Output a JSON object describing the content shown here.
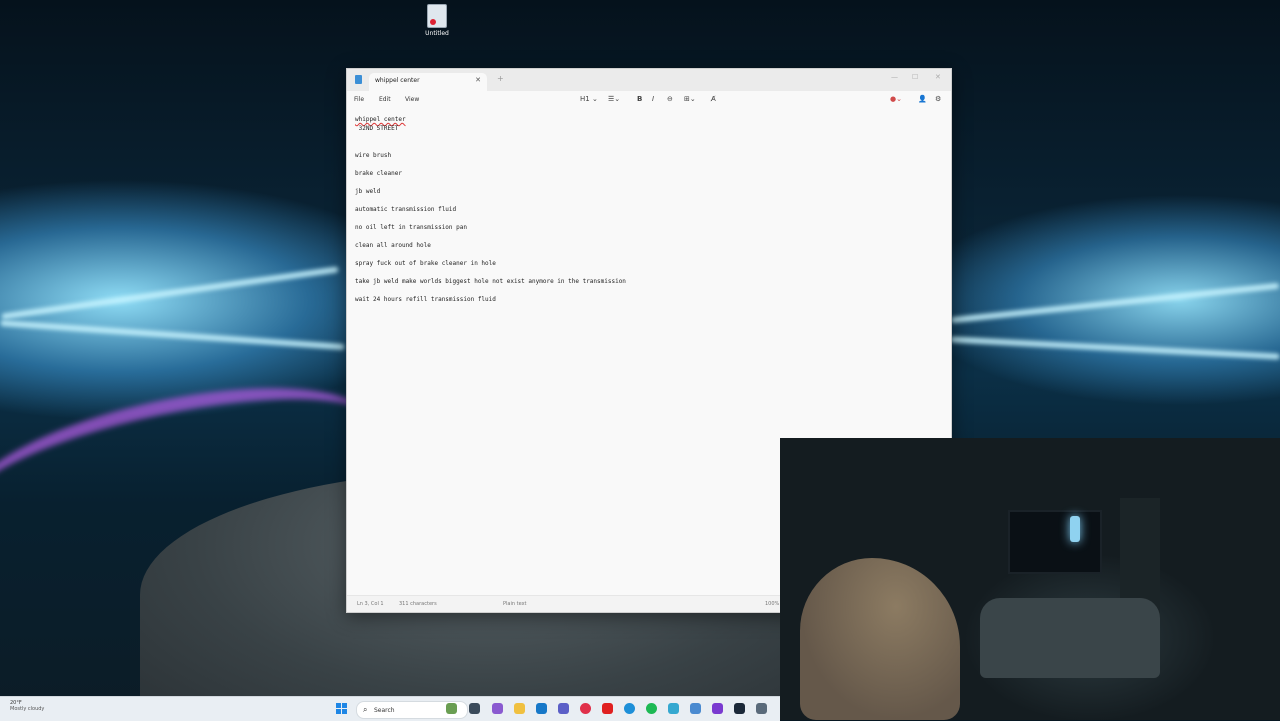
{
  "desktop": {
    "icon_label": "Untitled"
  },
  "notepad": {
    "tab_title": "whippel center",
    "menus": [
      "File",
      "Edit",
      "View"
    ],
    "heading_select": "H1",
    "lines": [
      "whippel center",
      " 32ND STREET",
      "",
      "",
      "wire brush",
      "",
      "brake cleaner",
      "",
      "jb weld",
      "",
      "automatic transmission fluid",
      "",
      "no oil left in transmission pan",
      "",
      "clean all around hole",
      "",
      "spray fuck out of brake cleaner in hole",
      "",
      "take jb weld make worlds biggest hole not exist anymore in the transmission",
      "",
      "wait 24 hours refill transmission fluid"
    ],
    "status": {
      "position": "Ln 3, Col 1",
      "characters": "311 characters",
      "format": "Plain text",
      "zoom": "100%"
    }
  },
  "taskbar": {
    "weather_temp": "20°F",
    "weather_desc": "Mostly cloudy",
    "search_placeholder": "Search"
  }
}
